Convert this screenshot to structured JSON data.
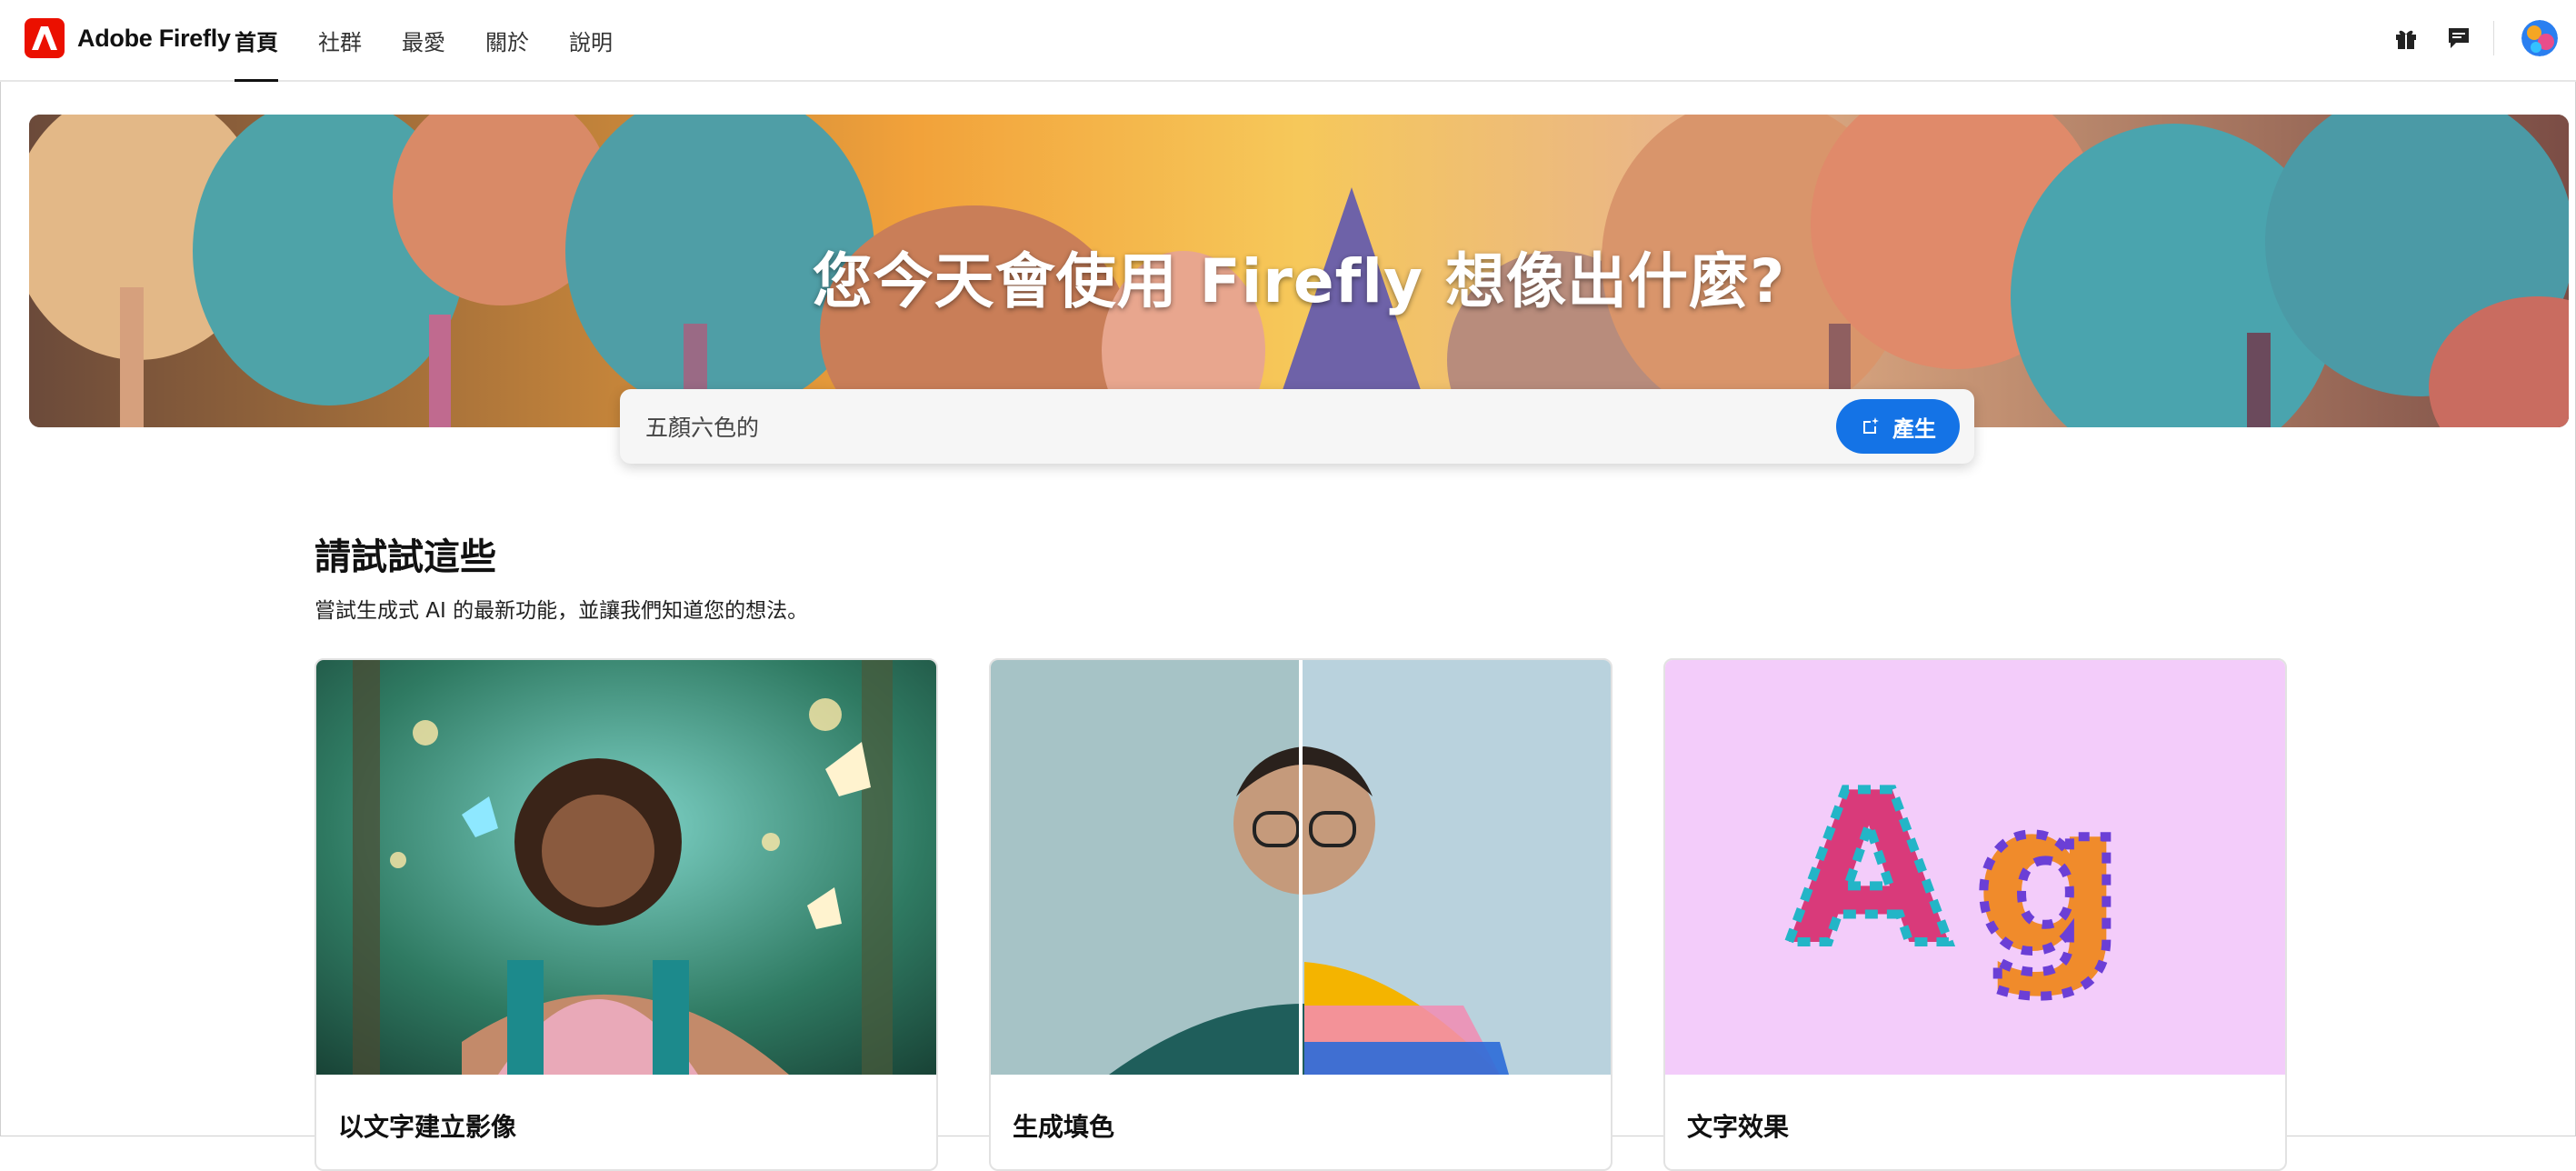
{
  "app": {
    "name": "Adobe Firefly"
  },
  "nav": [
    {
      "label": "首頁",
      "active": true
    },
    {
      "label": "社群",
      "active": false
    },
    {
      "label": "最愛",
      "active": false
    },
    {
      "label": "關於",
      "active": false
    },
    {
      "label": "說明",
      "active": false
    }
  ],
  "header_icons": [
    "gift-icon",
    "chat-icon",
    "avatar"
  ],
  "hero": {
    "title": "您今天會使用 Firefly 想像出什麼?"
  },
  "prompt": {
    "value": "五顏六色的",
    "generate_label": "產生"
  },
  "section": {
    "title": "請試試這些",
    "subtitle": "嘗試生成式 AI 的最新功能，並讓我們知道您的想法。"
  },
  "cards": [
    {
      "label": "以文字建立影像"
    },
    {
      "label": "生成填色"
    },
    {
      "label": "文字效果"
    }
  ],
  "colors": {
    "accent": "#1473e6",
    "brand": "#eb1000",
    "card3_bg": "#f3ccfa"
  }
}
